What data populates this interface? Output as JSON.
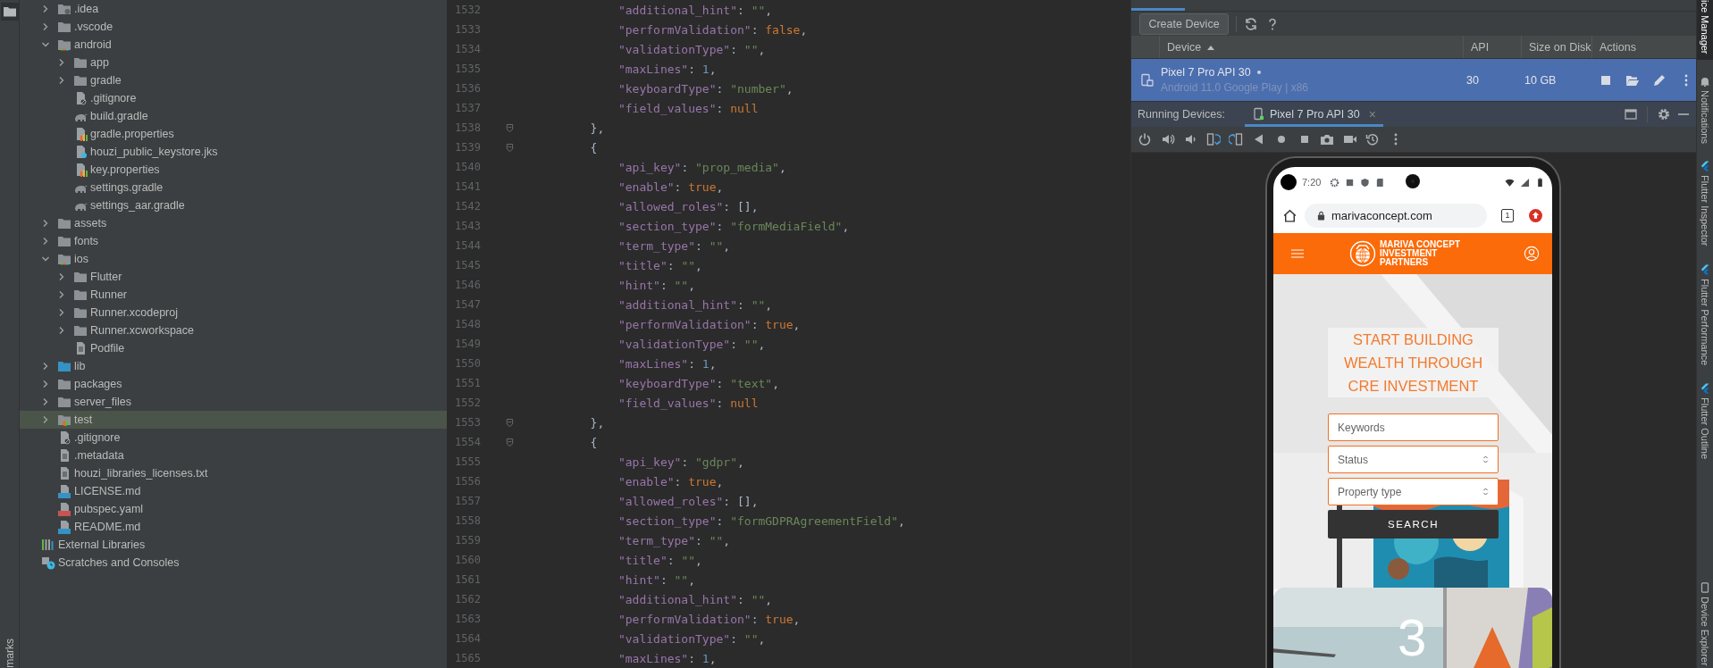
{
  "left_strip": {
    "label": "marks"
  },
  "project_tree": {
    "items": [
      {
        "label": ".idea",
        "kind": "idea",
        "expanded": false,
        "selected": false
      },
      {
        "label": ".vscode",
        "kind": "folder",
        "expanded": false,
        "selected": false
      },
      {
        "label": "android",
        "kind": "module",
        "expanded": true,
        "selected": false,
        "children": [
          {
            "label": "app",
            "kind": "folder",
            "expanded": false,
            "selected": false
          },
          {
            "label": "gradle",
            "kind": "folder",
            "expanded": false,
            "selected": false
          },
          {
            "label": ".gitignore",
            "kind": "ignore",
            "selected": false
          },
          {
            "label": "build.gradle",
            "kind": "gradle",
            "selected": false
          },
          {
            "label": "gradle.properties",
            "kind": "props",
            "selected": false
          },
          {
            "label": "houzi_public_keystore.jks",
            "kind": "unknown",
            "selected": false
          },
          {
            "label": "key.properties",
            "kind": "props",
            "selected": false
          },
          {
            "label": "settings.gradle",
            "kind": "gradle",
            "selected": false
          },
          {
            "label": "settings_aar.gradle",
            "kind": "gradle",
            "selected": false
          }
        ]
      },
      {
        "label": "assets",
        "kind": "folder",
        "expanded": false,
        "selected": false
      },
      {
        "label": "fonts",
        "kind": "folder",
        "expanded": false,
        "selected": false
      },
      {
        "label": "ios",
        "kind": "module",
        "expanded": true,
        "selected": false,
        "children": [
          {
            "label": "Flutter",
            "kind": "folder",
            "expanded": false,
            "selected": false
          },
          {
            "label": "Runner",
            "kind": "folder",
            "expanded": false,
            "selected": false
          },
          {
            "label": "Runner.xcodeproj",
            "kind": "folder",
            "expanded": false,
            "selected": false
          },
          {
            "label": "Runner.xcworkspace",
            "kind": "folder",
            "expanded": false,
            "selected": false
          },
          {
            "label": "Podfile",
            "kind": "text",
            "selected": false
          }
        ]
      },
      {
        "label": "lib",
        "kind": "source",
        "expanded": false,
        "selected": false
      },
      {
        "label": "packages",
        "kind": "folder",
        "expanded": false,
        "selected": false
      },
      {
        "label": "server_files",
        "kind": "folder",
        "expanded": false,
        "selected": false
      },
      {
        "label": "test",
        "kind": "test",
        "expanded": false,
        "selected": true
      },
      {
        "label": ".gitignore",
        "kind": "ignore",
        "selected": false
      },
      {
        "label": ".metadata",
        "kind": "text",
        "selected": false
      },
      {
        "label": "houzi_libraries_licenses.txt",
        "kind": "text",
        "selected": false
      },
      {
        "label": "LICENSE.md",
        "kind": "md",
        "selected": false
      },
      {
        "label": "pubspec.yaml",
        "kind": "yaml",
        "selected": false
      },
      {
        "label": "README.md",
        "kind": "md",
        "selected": false
      }
    ],
    "footer": [
      {
        "label": "External Libraries",
        "kind": "libraries",
        "selected": false
      },
      {
        "label": "Scratches and Consoles",
        "kind": "scratches",
        "selected": false
      }
    ]
  },
  "editor": {
    "lines": [
      {
        "number": "1532",
        "text": "            \"additional_hint\": \"\","
      },
      {
        "number": "1533",
        "text": "            \"performValidation\": false,"
      },
      {
        "number": "1534",
        "text": "            \"validationType\": \"\","
      },
      {
        "number": "1535",
        "text": "            \"maxLines\": 1,"
      },
      {
        "number": "1536",
        "text": "            \"keyboardType\": \"number\","
      },
      {
        "number": "1537",
        "text": "            \"field_values\": null"
      },
      {
        "number": "1538",
        "text": "        },",
        "fold": true
      },
      {
        "number": "1539",
        "text": "        {",
        "fold": true
      },
      {
        "number": "1540",
        "text": "            \"api_key\": \"prop_media\","
      },
      {
        "number": "1541",
        "text": "            \"enable\": true,"
      },
      {
        "number": "1542",
        "text": "            \"allowed_roles\": [],"
      },
      {
        "number": "1543",
        "text": "            \"section_type\": \"formMediaField\","
      },
      {
        "number": "1544",
        "text": "            \"term_type\": \"\","
      },
      {
        "number": "1545",
        "text": "            \"title\": \"\","
      },
      {
        "number": "1546",
        "text": "            \"hint\": \"\","
      },
      {
        "number": "1547",
        "text": "            \"additional_hint\": \"\","
      },
      {
        "number": "1548",
        "text": "            \"performValidation\": true,"
      },
      {
        "number": "1549",
        "text": "            \"validationType\": \"\","
      },
      {
        "number": "1550",
        "text": "            \"maxLines\": 1,"
      },
      {
        "number": "1551",
        "text": "            \"keyboardType\": \"text\","
      },
      {
        "number": "1552",
        "text": "            \"field_values\": null"
      },
      {
        "number": "1553",
        "text": "        },",
        "fold": true
      },
      {
        "number": "1554",
        "text": "        {",
        "fold": true
      },
      {
        "number": "1555",
        "text": "            \"api_key\": \"gdpr\","
      },
      {
        "number": "1556",
        "text": "            \"enable\": true,"
      },
      {
        "number": "1557",
        "text": "            \"allowed_roles\": [],"
      },
      {
        "number": "1558",
        "text": "            \"section_type\": \"formGDPRAgreementField\","
      },
      {
        "number": "1559",
        "text": "            \"term_type\": \"\","
      },
      {
        "number": "1560",
        "text": "            \"title\": \"\","
      },
      {
        "number": "1561",
        "text": "            \"hint\": \"\","
      },
      {
        "number": "1562",
        "text": "            \"additional_hint\": \"\","
      },
      {
        "number": "1563",
        "text": "            \"performValidation\": true,"
      },
      {
        "number": "1564",
        "text": "            \"validationType\": \"\","
      },
      {
        "number": "1565",
        "text": "            \"maxLines\": 1,"
      }
    ]
  },
  "device_manager": {
    "create_button": "Create Device",
    "columns": [
      {
        "label": "Device",
        "sorted": true
      },
      {
        "label": "API",
        "sorted": false
      },
      {
        "label": "Size on Disk",
        "sorted": false
      },
      {
        "label": "Actions",
        "sorted": false
      }
    ],
    "devices": [
      {
        "name": "Pixel 7 Pro API 30",
        "details": "Android 11.0 Google Play | x86",
        "api": "30",
        "size": "10 GB",
        "selected": true
      }
    ]
  },
  "running_devices": {
    "label": "Running Devices:",
    "tabs": [
      {
        "label": "Pixel 7 Pro API 30",
        "close": "×",
        "selected": true
      }
    ]
  },
  "emulator": {
    "time": "7:20",
    "url": "marivaconcept.com",
    "tab_count": "1",
    "brand": "MARIVA CONCEPT\nINVESTMENT\nPARTNERS",
    "headline": "START BUILDING\nWEALTH THROUGH\nCRE INVESTMENT",
    "fields": [
      {
        "kind": "text",
        "placeholder": "Keywords"
      },
      {
        "kind": "select",
        "value": "Status"
      },
      {
        "kind": "select",
        "value": "Property type"
      }
    ],
    "search_button": "SEARCH",
    "card_number": "3"
  },
  "tool_strip": [
    {
      "label": "ice Manager",
      "kind": "plain",
      "selected": true
    },
    {
      "label": "Notifications",
      "kind": "bell",
      "selected": false
    },
    {
      "label": "Flutter Inspector",
      "kind": "flutter",
      "selected": false
    },
    {
      "label": "Flutter Performance",
      "kind": "flutter",
      "selected": false
    },
    {
      "label": "Flutter Outline",
      "kind": "flutter",
      "selected": false
    },
    {
      "label": "Device Explorer",
      "kind": "device",
      "selected": false
    }
  ]
}
